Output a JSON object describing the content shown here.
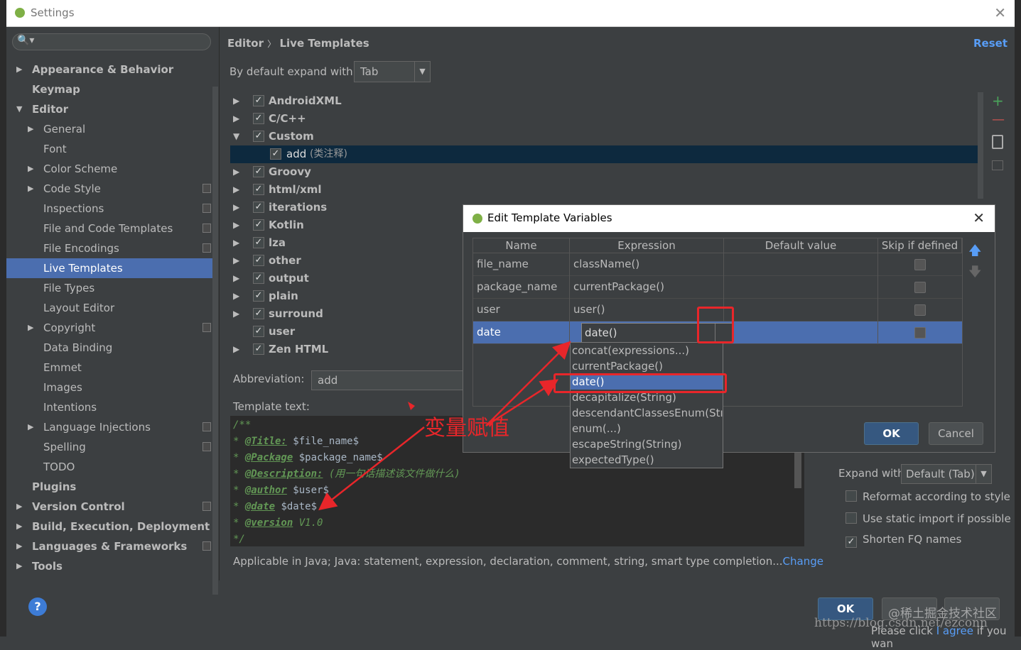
{
  "window": {
    "title": "Settings"
  },
  "sidebar": {
    "items": [
      {
        "label": "Appearance & Behavior",
        "arrow": "▶"
      },
      {
        "label": "Keymap"
      },
      {
        "label": "Editor",
        "arrow": "▼"
      },
      {
        "label": "General",
        "arrow": "▶"
      },
      {
        "label": "Font"
      },
      {
        "label": "Color Scheme",
        "arrow": "▶"
      },
      {
        "label": "Code Style",
        "arrow": "▶"
      },
      {
        "label": "Inspections"
      },
      {
        "label": "File and Code Templates"
      },
      {
        "label": "File Encodings"
      },
      {
        "label": "Live Templates"
      },
      {
        "label": "File Types"
      },
      {
        "label": "Layout Editor"
      },
      {
        "label": "Copyright",
        "arrow": "▶"
      },
      {
        "label": "Data Binding"
      },
      {
        "label": "Emmet"
      },
      {
        "label": "Images"
      },
      {
        "label": "Intentions"
      },
      {
        "label": "Language Injections",
        "arrow": "▶"
      },
      {
        "label": "Spelling"
      },
      {
        "label": "TODO"
      },
      {
        "label": "Plugins"
      },
      {
        "label": "Version Control",
        "arrow": "▶"
      },
      {
        "label": "Build, Execution, Deployment",
        "arrow": "▶"
      },
      {
        "label": "Languages & Frameworks",
        "arrow": "▶"
      },
      {
        "label": "Tools",
        "arrow": "▶"
      }
    ]
  },
  "header": {
    "breadcrumb_1": "Editor",
    "breadcrumb_sep": "〉",
    "breadcrumb_2": "Live Templates",
    "reset": "Reset"
  },
  "expand_default": {
    "label": "By default expand with",
    "value": "Tab"
  },
  "template_groups": [
    {
      "label": "AndroidXML",
      "arrow": "▶",
      "checked": "✓"
    },
    {
      "label": "C/C++",
      "arrow": "▶",
      "checked": "✓"
    },
    {
      "label": "Custom",
      "arrow": "▼",
      "checked": "✓"
    },
    {
      "label": "add",
      "sub": "(类注释)",
      "checked": "✓"
    },
    {
      "label": "Groovy",
      "arrow": "▶",
      "checked": "✓"
    },
    {
      "label": "html/xml",
      "arrow": "▶",
      "checked": "✓"
    },
    {
      "label": "iterations",
      "arrow": "▶",
      "checked": "✓"
    },
    {
      "label": "Kotlin",
      "arrow": "▶",
      "checked": "✓"
    },
    {
      "label": "lza",
      "arrow": "▶",
      "checked": "✓"
    },
    {
      "label": "other",
      "arrow": "▶",
      "checked": "✓"
    },
    {
      "label": "output",
      "arrow": "▶",
      "checked": "✓"
    },
    {
      "label": "plain",
      "arrow": "▶",
      "checked": "✓"
    },
    {
      "label": "surround",
      "arrow": "▶",
      "checked": "✓"
    },
    {
      "label": "user",
      "checked": "✓"
    },
    {
      "label": "Zen HTML",
      "arrow": "▶",
      "checked": "✓"
    }
  ],
  "side_tools": {
    "add": "+",
    "remove": "—"
  },
  "abbreviation": {
    "label": "Abbreviation:",
    "value": "add"
  },
  "template_text": {
    "label": "Template text:",
    "lines": [
      {
        "prefix": "/**",
        "tag": "",
        "value": ""
      },
      {
        "prefix": "* ",
        "tag": "@Title:",
        "value": " $file_name$"
      },
      {
        "prefix": "* ",
        "tag": "@Package",
        "value": " $package_name$"
      },
      {
        "prefix": "* ",
        "tag": "@Description:",
        "value": " (用一句话描述该文件做什么)"
      },
      {
        "prefix": "* ",
        "tag": "@author",
        "value": " $user$"
      },
      {
        "prefix": "* ",
        "tag": "@date",
        "value": " $date$"
      },
      {
        "prefix": "* ",
        "tag": "@version",
        "value": " V1.0"
      },
      {
        "prefix": "*/",
        "tag": "",
        "value": ""
      }
    ]
  },
  "applicable": {
    "text": "Applicable in Java; Java: statement, expression, declaration, comment, string, smart type completion...",
    "link": "Change"
  },
  "options": {
    "expand_label": "Expand with",
    "expand_value": "Default (Tab)",
    "reformat": "Reformat according to style",
    "static_import": "Use static import if possible",
    "shorten": "Shorten FQ names",
    "shorten_check": "✓"
  },
  "footer": {
    "ok": "OK",
    "help": "?"
  },
  "dialog": {
    "title": "Edit Template Variables",
    "columns": [
      "Name",
      "Expression",
      "Default value",
      "Skip if defined"
    ],
    "rows": [
      {
        "name": "file_name",
        "expression": "className()",
        "default": ""
      },
      {
        "name": "package_name",
        "expression": "currentPackage()",
        "default": ""
      },
      {
        "name": "user",
        "expression": "user()",
        "default": ""
      },
      {
        "name": "date",
        "expression": "date()",
        "default": ""
      }
    ],
    "ok": "OK",
    "cancel": "Cancel",
    "up": "🡅",
    "down": "🡇"
  },
  "popup": {
    "items": [
      "concat(expressions...)",
      "currentPackage()",
      "date()",
      "decapitalize(String)",
      "descendantClassesEnum(Stı",
      "enum(...)",
      "escapeString(String)",
      "expectedType()"
    ],
    "selected": 2
  },
  "annotation": {
    "text": "变量赋值",
    "color": "#e8262a"
  },
  "watermark": {
    "community": "@稀土掘金技术社区",
    "url": "https://blog.csdn.net/ezconn",
    "bottom": "Please click ",
    "bottom_link": "I agree",
    "bottom_tail": " if you wan"
  },
  "colors": {
    "selection": "#4b6eaf",
    "link": "#589df6",
    "accent_red": "#e8262a"
  }
}
